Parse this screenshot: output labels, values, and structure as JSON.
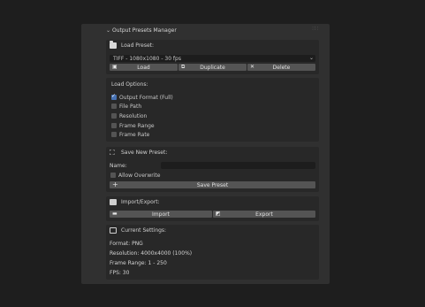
{
  "panel": {
    "title": "Output Presets Manager"
  },
  "load": {
    "title": "Load Preset:",
    "selected": "TIFF - 1080x1080 - 30 fps",
    "buttons": {
      "load": "Load",
      "duplicate": "Duplicate",
      "delete": "Delete"
    }
  },
  "options": {
    "title": "Load Options:",
    "items": [
      {
        "label": "Output Format (Full)",
        "checked": true
      },
      {
        "label": "File Path",
        "checked": false
      },
      {
        "label": "Resolution",
        "checked": false
      },
      {
        "label": "Frame Range",
        "checked": false
      },
      {
        "label": "Frame Rate",
        "checked": false
      }
    ]
  },
  "save": {
    "title": "Save New Preset:",
    "name_label": "Name:",
    "name_value": "",
    "overwrite_label": "Allow Overwrite",
    "save_button": "Save Preset"
  },
  "io": {
    "title": "Import/Export:",
    "import": "Import",
    "export": "Export"
  },
  "current": {
    "title": "Current Settings:",
    "format": "Format: PNG",
    "resolution": "Resolution: 4000x4000 (100%)",
    "frame_range": "Frame Range: 1 - 250",
    "fps": "FPS: 30"
  },
  "colors": {
    "accent": "#4772b3",
    "panel": "#303030",
    "background": "#1e1e1e"
  }
}
